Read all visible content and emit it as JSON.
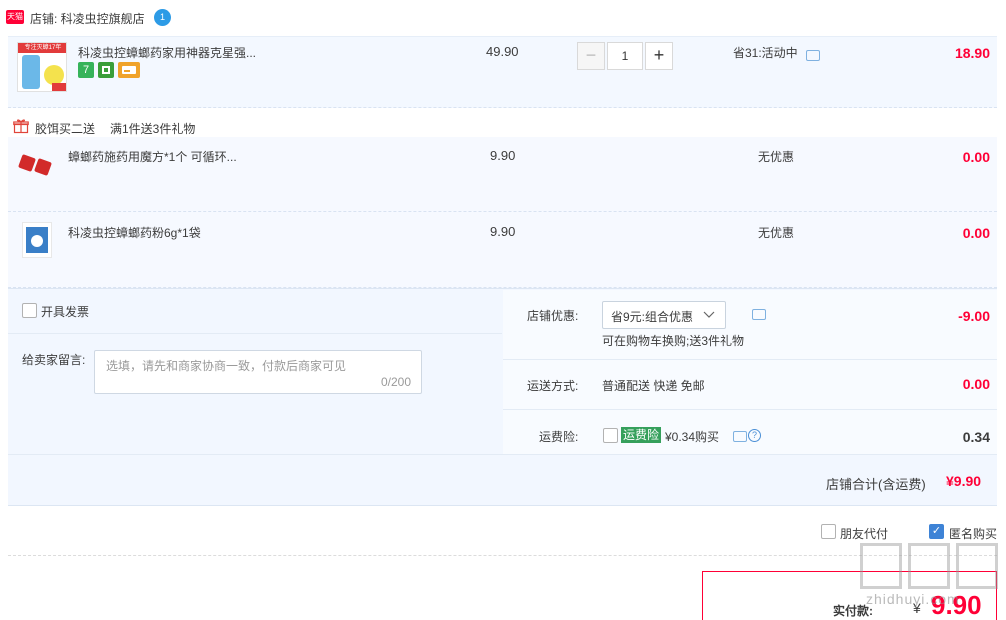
{
  "store": {
    "badge": "天猫",
    "label": "店铺: 科凌虫控旗舰店",
    "icon": "wangwang-icon"
  },
  "main_item": {
    "thumb_banner": "专注灭蟑17年",
    "title": "科凌虫控蟑螂药家用神器克星强...",
    "badges": [
      "7",
      "",
      ""
    ],
    "price": "49.90",
    "quantity": "1",
    "minus": "−",
    "plus": "+",
    "promo": "省31:活动中",
    "amount": "18.90"
  },
  "gift": {
    "title": "胶饵买二送",
    "desc": "满1件送3件礼物",
    "items": [
      {
        "title": "蟑螂药施药用魔方*1个 可循环...",
        "price": "9.90",
        "promo": "无优惠",
        "amount": "0.00"
      },
      {
        "title": "科凌虫控蟑螂药粉6g*1袋",
        "price": "9.90",
        "promo": "无优惠",
        "amount": "0.00"
      }
    ]
  },
  "options": {
    "invoice_label": "开具发票",
    "message_label": "给卖家留言:",
    "message_placeholder": "选填，请先和商家协商一致，付款后商家可见",
    "message_count": "0/200",
    "discount_label": "店铺优惠:",
    "discount_select": "省9元:组合优惠",
    "discount_note": "可在购物车换购;送3件礼物",
    "discount_value": "-9.00",
    "shipping_label": "运送方式:",
    "shipping_method": "普通配送 快递 免邮",
    "shipping_value": "0.00",
    "insurance_label": "运费险:",
    "insurance_tag": "运费险",
    "insurance_price": "¥0.34购买",
    "insurance_value": "0.34",
    "help_glyph": "?",
    "store_total_label": "店铺合计(含运费)",
    "store_total_value": "¥9.90"
  },
  "footer": {
    "friend_pay_label": "朋友代付",
    "anonymous_label": "匿名购买",
    "anonymous_checked": "✓",
    "final_label": "实付款:",
    "final_currency": "¥",
    "final_amount": "9.90"
  },
  "watermark": {
    "text": "zhidhuyi.com"
  },
  "colors": {
    "accent_red": "#ff0036",
    "tmall_red": "#ff0036",
    "link_blue": "#3e83d6",
    "row_bg": "#f3f8ff",
    "insurance_green": "#36a05c"
  }
}
